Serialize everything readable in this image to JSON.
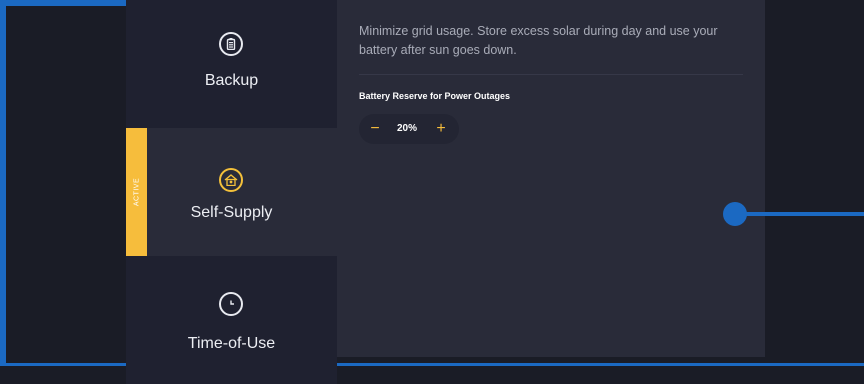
{
  "modes": [
    {
      "label": "Backup",
      "icon": "battery-icon",
      "active": false
    },
    {
      "label": "Self-Supply",
      "icon": "solar-home-icon",
      "active": true,
      "badge": "ACTIVE"
    },
    {
      "label": "Time-of-Use",
      "icon": "clock-icon",
      "active": false
    }
  ],
  "content": {
    "description": "Minimize grid usage. Store excess solar during day and use your battery after sun goes down.",
    "reserve_label": "Battery Reserve for Power Outages",
    "reserve_value": "20%",
    "minus_symbol": "−",
    "plus_symbol": "+"
  },
  "colors": {
    "accent": "#f6bd3c",
    "highlight_border": "#1b69c2",
    "panel": "#292b39",
    "background": "#1a1c26"
  }
}
